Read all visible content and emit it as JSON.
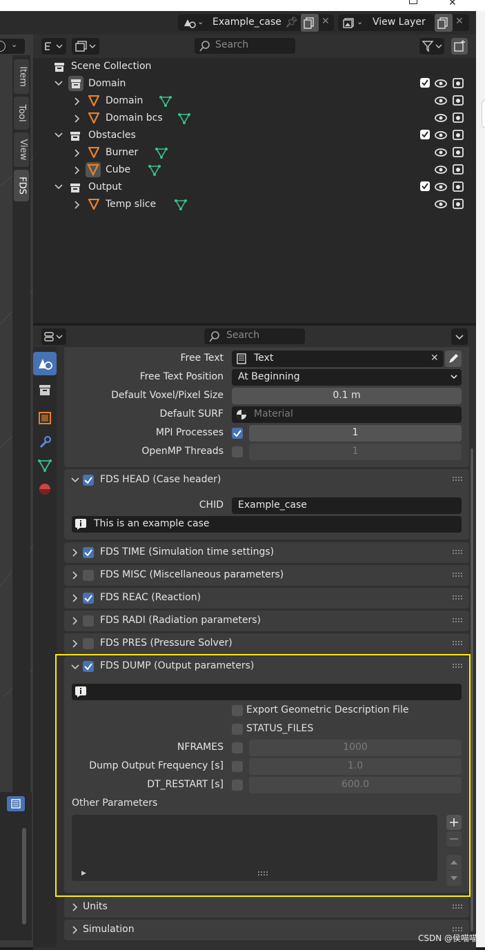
{
  "header": {
    "scene_name": "Example_case",
    "view_layer": "View Layer"
  },
  "outliner": {
    "search_placeholder": "Search",
    "rows": [
      {
        "label": "Scene Collection"
      },
      {
        "label": "Domain"
      },
      {
        "label": "Domain"
      },
      {
        "label": "Domain bcs"
      },
      {
        "label": "Obstacles"
      },
      {
        "label": "Burner"
      },
      {
        "label": "Cube"
      },
      {
        "label": "Output"
      },
      {
        "label": "Temp slice"
      }
    ]
  },
  "side_tabs": [
    "Item",
    "Tool",
    "View",
    "FDS"
  ],
  "properties": {
    "search_placeholder": "Search",
    "free_text": {
      "label": "Free Text",
      "value": "Text"
    },
    "free_text_position": {
      "label": "Free Text Position",
      "value": "At Beginning"
    },
    "voxel_size": {
      "label": "Default Voxel/Pixel Size",
      "value": "0.1 m"
    },
    "default_surf": {
      "label": "Default SURF",
      "placeholder": "Material"
    },
    "mpi": {
      "label": "MPI Processes",
      "value": "1",
      "checked": true
    },
    "openmp": {
      "label": "OpenMP Threads",
      "value": "1",
      "checked": false
    },
    "head": {
      "title": "FDS HEAD (Case header)",
      "checked": true,
      "chid_label": "CHID",
      "chid_value": "Example_case",
      "title_value": "This is an example case"
    },
    "collapsed_panels": [
      {
        "title": "FDS TIME (Simulation time settings)",
        "checked": true
      },
      {
        "title": "FDS MISC (Miscellaneous parameters)",
        "checked": false
      },
      {
        "title": "FDS REAC (Reaction)",
        "checked": true
      },
      {
        "title": "FDS RADI (Radiation parameters)",
        "checked": false
      },
      {
        "title": "FDS PRES (Pressure Solver)",
        "checked": false
      }
    ],
    "dump": {
      "title": "FDS DUMP (Output parameters)",
      "checked": true,
      "export_geom": "Export Geometric Description File",
      "status_files": "STATUS_FILES",
      "nframes": {
        "label": "NFRAMES",
        "value": "1000"
      },
      "dump_freq": {
        "label": "Dump Output Frequency [s]",
        "value": "1.0"
      },
      "dt_restart": {
        "label": "DT_RESTART [s]",
        "value": "600.0"
      },
      "other_params": "Other Parameters"
    },
    "bottom_panels": [
      {
        "title": "Units"
      },
      {
        "title": "Simulation"
      }
    ]
  },
  "watermark": "CSDN @侯喵喵",
  "colors": {
    "highlight_frame": "#ffee00",
    "checkbox_on": "#4772b3",
    "object_icon": "#e8822d",
    "mesh_icon": "#36c48c"
  }
}
